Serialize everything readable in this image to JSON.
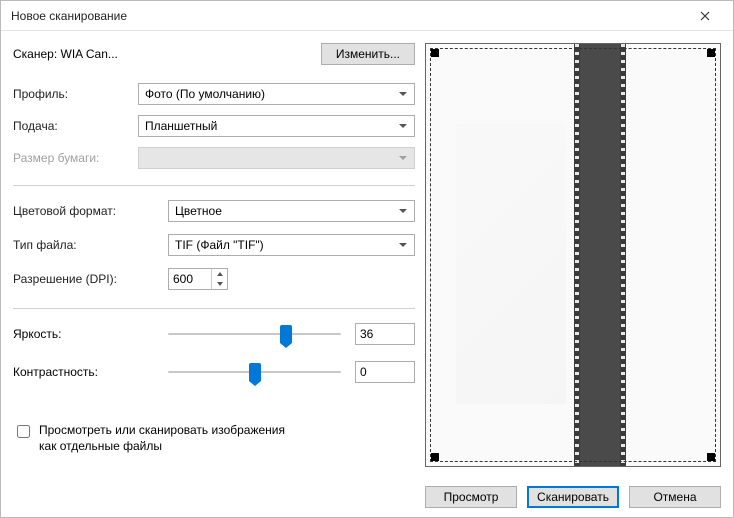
{
  "window": {
    "title": "Новое сканирование"
  },
  "scanner": {
    "prefix": "Сканер:",
    "name": "WIA Can...",
    "change_btn": "Изменить..."
  },
  "profile": {
    "label": "Профиль:",
    "value": "Фото (По умолчанию)"
  },
  "source": {
    "label": "Подача:",
    "value": "Планшетный"
  },
  "paper": {
    "label": "Размер бумаги:",
    "value": ""
  },
  "color": {
    "label": "Цветовой формат:",
    "value": "Цветное"
  },
  "filetype": {
    "label": "Тип файла:",
    "value": "TIF (Файл \"TIF\")"
  },
  "dpi": {
    "label": "Разрешение (DPI):",
    "value": "600"
  },
  "brightness": {
    "label": "Яркость:",
    "value": "36",
    "percent": 68
  },
  "contrast": {
    "label": "Контрастность:",
    "value": "0",
    "percent": 50
  },
  "separate_files": {
    "label": "Просмотреть или сканировать изображения как отдельные файлы",
    "checked": false
  },
  "buttons": {
    "preview": "Просмотр",
    "scan": "Сканировать",
    "cancel": "Отмена"
  }
}
